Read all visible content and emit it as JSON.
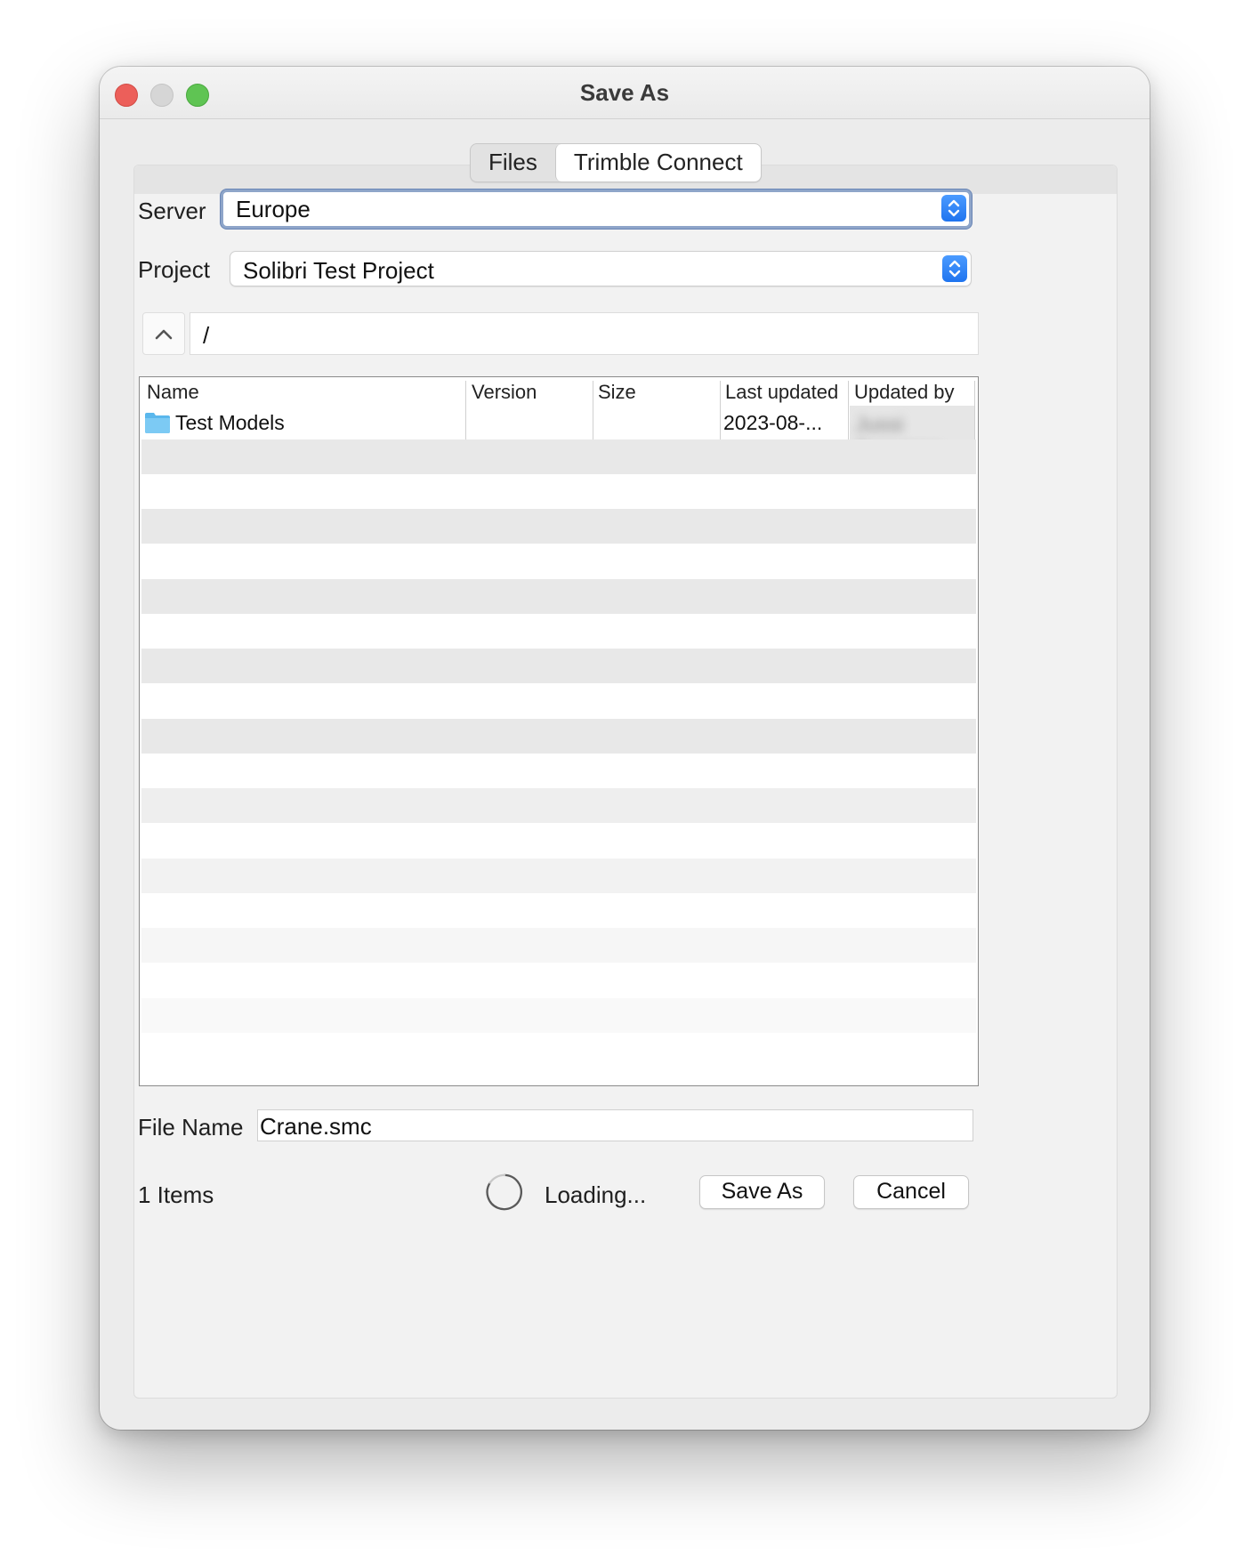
{
  "window": {
    "title": "Save As"
  },
  "tabs": [
    {
      "label": "Files",
      "selected": false
    },
    {
      "label": "Trimble Connect",
      "selected": true
    }
  ],
  "server": {
    "label": "Server",
    "value": "Europe"
  },
  "project": {
    "label": "Project",
    "value": "Solibri Test Project"
  },
  "path": {
    "value": "/"
  },
  "table": {
    "columns": [
      "Name",
      "Version",
      "Size",
      "Last updated",
      "Updated by"
    ],
    "rows": [
      {
        "name": "Test Models",
        "version": "",
        "size": "",
        "last_updated": "2023-08-...",
        "updated_by": "Jussi Saramaa"
      }
    ]
  },
  "file_name": {
    "label": "File Name",
    "value": "Crane.smc"
  },
  "status": {
    "items": "1 Items",
    "loading": "Loading..."
  },
  "buttons": {
    "save_as": "Save As",
    "cancel": "Cancel"
  },
  "colors": {
    "accent": "#1f74ef",
    "close": "#ec5f5a",
    "maximize": "#5fc453"
  }
}
